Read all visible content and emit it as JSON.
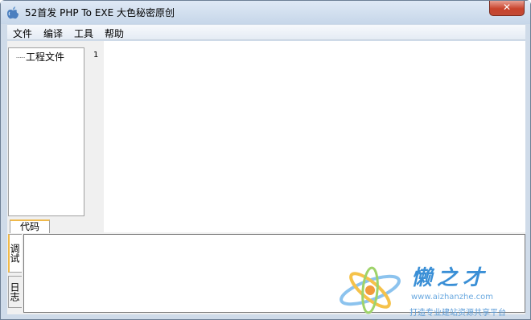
{
  "window": {
    "title": "52首发 PHP To EXE 大色秘密原创",
    "close_label": "✕"
  },
  "menubar": {
    "items": [
      "文件",
      "编译",
      "工具",
      "帮助"
    ]
  },
  "project_tree": {
    "root_label": "工程文件"
  },
  "editor": {
    "line_numbers": [
      "1"
    ]
  },
  "tabs": {
    "editor_tab": "代码",
    "log_tabs": [
      "调试",
      "日志"
    ]
  },
  "watermark": {
    "title": "懒之才",
    "url": "www.aizhanzhe.com",
    "slogan": "打造专业建站资源共享平台"
  },
  "colors": {
    "accent_tab": "#f0b94a",
    "close_button": "#c8432c",
    "watermark_blue": "#3a8fd6"
  }
}
